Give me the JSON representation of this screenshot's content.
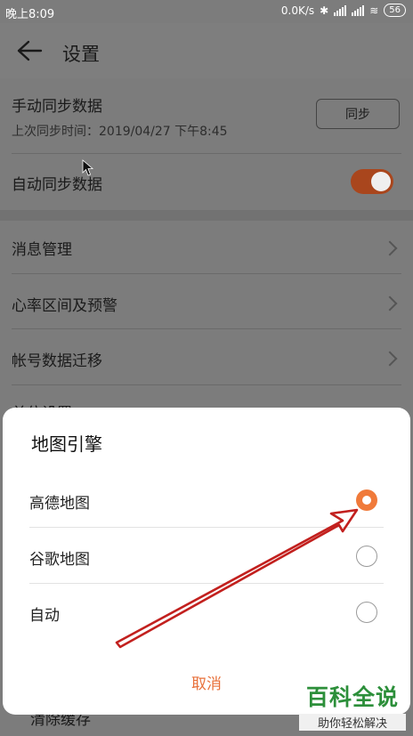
{
  "status_bar": {
    "time": "晚上8:09",
    "speed": "0.0K/s",
    "battery": "56"
  },
  "header": {
    "title": "设置"
  },
  "manual_sync": {
    "label": "手动同步数据",
    "last_sync": "上次同步时间：2019/04/27 下午8:45",
    "button": "同步"
  },
  "auto_sync": {
    "label": "自动同步数据",
    "enabled": true
  },
  "settings_list": [
    {
      "label": "消息管理"
    },
    {
      "label": "心率区间及预警"
    },
    {
      "label": "帐号数据迁移"
    },
    {
      "label": "单位设置"
    }
  ],
  "bottom_item_partial": "清除缓存",
  "dialog": {
    "title": "地图引擎",
    "options": [
      {
        "label": "高德地图",
        "selected": true
      },
      {
        "label": "谷歌地图",
        "selected": false
      },
      {
        "label": "自动",
        "selected": false
      }
    ],
    "cancel": "取消"
  },
  "watermark": {
    "main": "百科全说",
    "sub": "助你轻松解决"
  },
  "colors": {
    "accent": "#f07a3a",
    "toggle_dimmed": "#a9461d",
    "arrow": "#c2201e",
    "watermark": "#2c8f3a"
  }
}
